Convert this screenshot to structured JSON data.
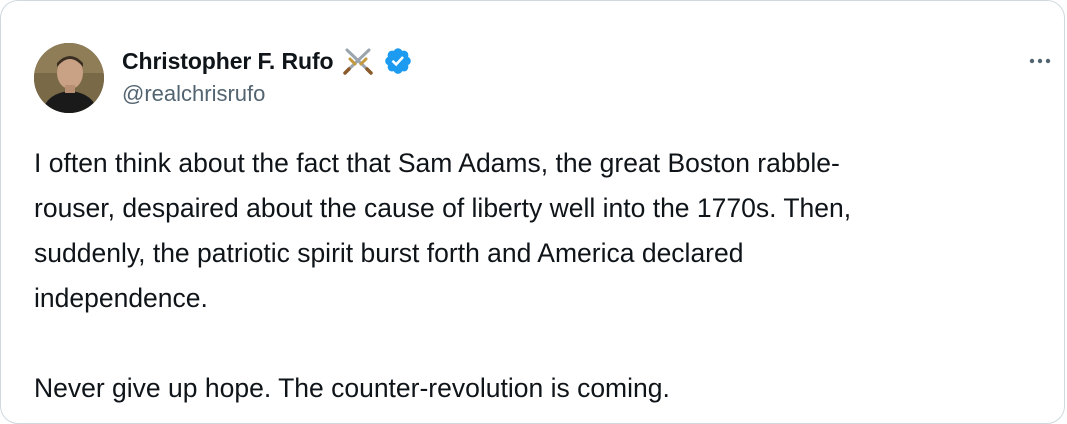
{
  "tweet": {
    "author": {
      "display_name": "Christopher F. Rufo",
      "handle": "@realchrisrufo",
      "emoji": "crossed-swords-icon",
      "verified": true,
      "avatar": "avatar-photo"
    },
    "more_icon": "more-options-icon",
    "paragraph1_lines": [
      "I often think about the fact that Sam Adams, the great Boston rabble-",
      "rouser, despaired about the cause of liberty well into the 1770s. Then,",
      "suddenly, the patriotic spirit burst forth and America declared",
      "independence."
    ],
    "paragraph2": "Never give up hope. The counter-revolution is coming."
  },
  "colors": {
    "text": "#0f1419",
    "secondary_text": "#536471",
    "verified_blue": "#1d9bf0",
    "border": "#cfd9de"
  }
}
